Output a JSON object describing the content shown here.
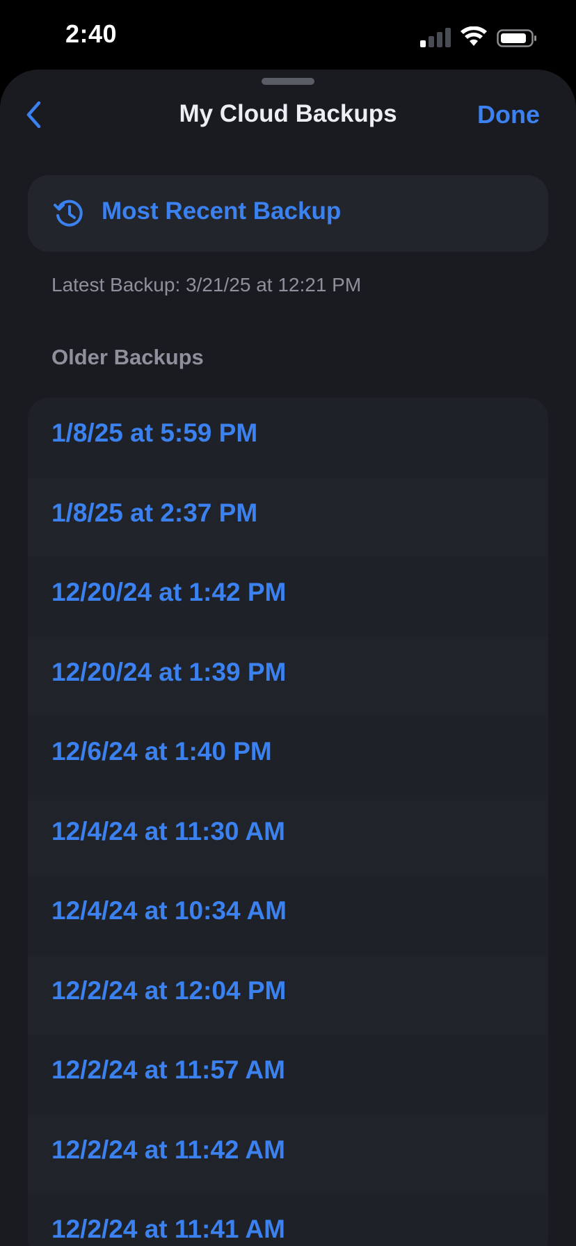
{
  "status_bar": {
    "time": "2:40",
    "signal_icon": "cellular-signal-icon",
    "wifi_icon": "wifi-icon",
    "battery_icon": "battery-icon",
    "signal_bars_active": 1
  },
  "nav": {
    "back_icon": "chevron-left-icon",
    "title": "My Cloud Backups",
    "done_label": "Done"
  },
  "recent": {
    "icon": "history-clock-icon",
    "label": "Most Recent Backup",
    "latest_text": "Latest Backup: 3/21/25 at 12:21 PM"
  },
  "older": {
    "header": "Older Backups",
    "items": [
      "1/8/25 at 5:59 PM",
      "1/8/25 at 2:37 PM",
      "12/20/24 at 1:42 PM",
      "12/20/24 at 1:39 PM",
      "12/6/24 at 1:40 PM",
      "12/4/24 at 11:30 AM",
      "12/4/24 at 10:34 AM",
      "12/2/24 at 12:04 PM",
      "12/2/24 at 11:57 AM",
      "12/2/24 at 11:42 AM",
      "12/2/24 at 11:41 AM"
    ]
  },
  "colors": {
    "accent": "#3b82f0",
    "sheet_background": "#1a1b21",
    "card_background": "#23252d",
    "secondary_text": "#8e919c"
  }
}
